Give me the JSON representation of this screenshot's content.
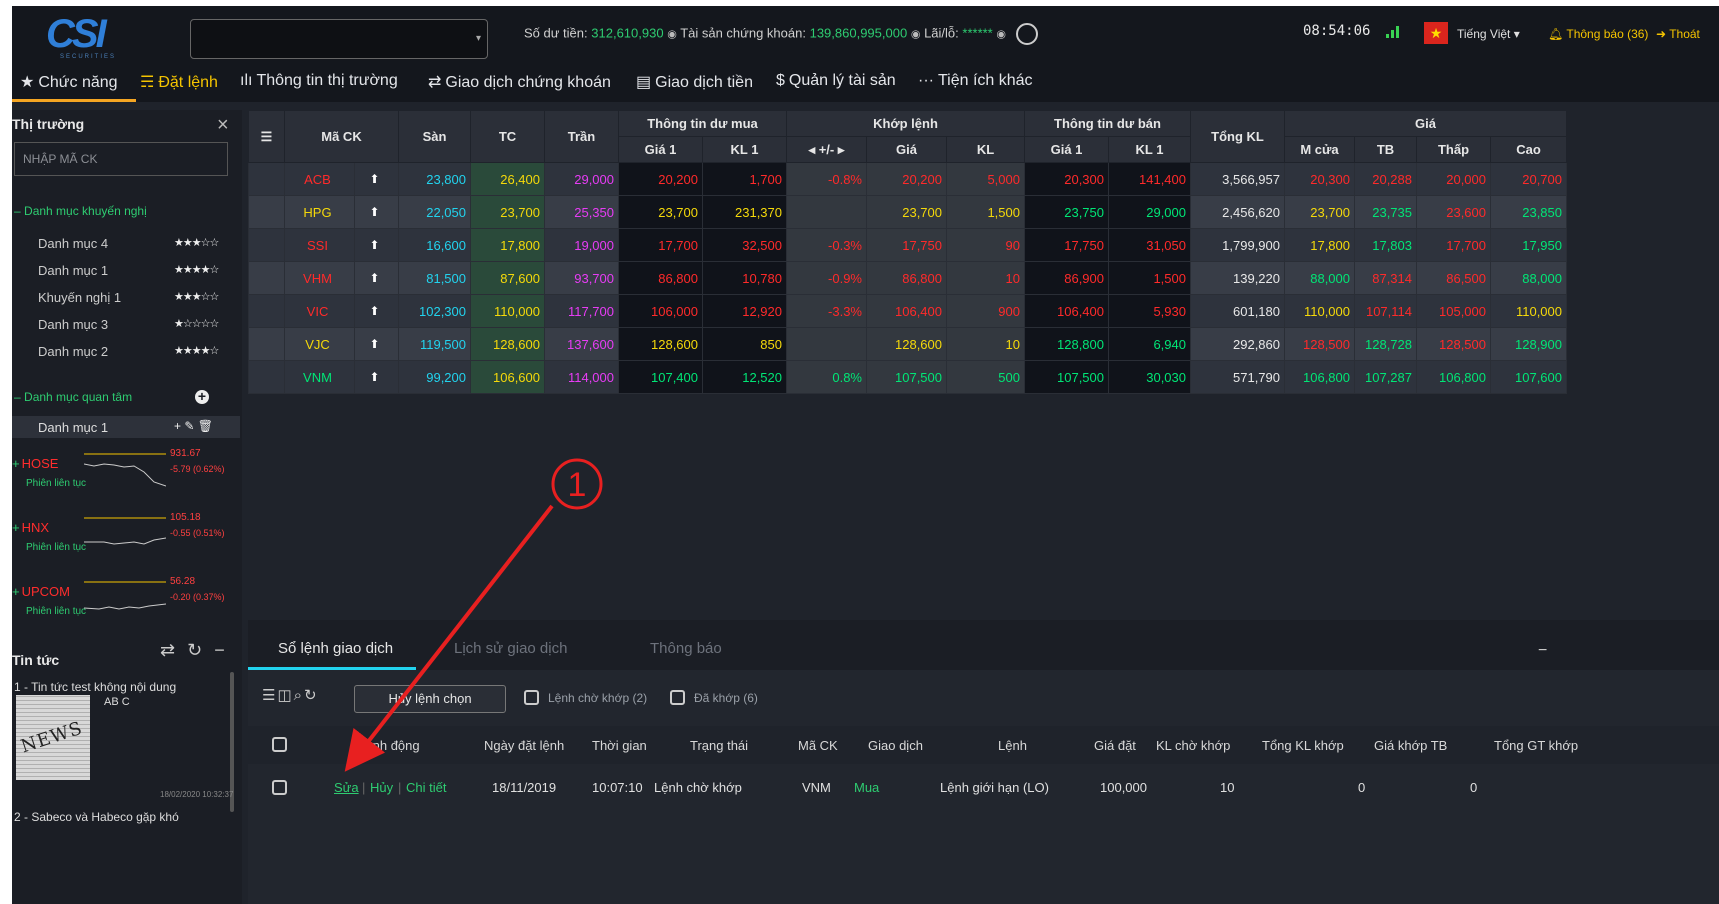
{
  "topbar": {
    "logo": "CSI",
    "logo_sub": "SECURITIES",
    "account_select": "",
    "balance_label": "Số dư tiền:",
    "balance_value": "312,610,930",
    "assets_label": "Tài sản chứng khoán:",
    "assets_value": "139,860,995,000",
    "pnl_label": "Lãi/lỗ:",
    "pnl_value": "******",
    "clock": "08:54:06",
    "language": "Tiếng Việt",
    "notifications": "Thông báo (36)",
    "logout": "Thoát"
  },
  "menu": [
    {
      "label": "Chức năng",
      "icon": "star-icon"
    },
    {
      "label": "Đặt lệnh",
      "icon": "cart-icon"
    },
    {
      "label": "Thông tin thị trường",
      "icon": "bar-chart-icon"
    },
    {
      "label": "Giao dịch chứng khoán",
      "icon": "transfer-icon"
    },
    {
      "label": "Giao dịch tiền",
      "icon": "cash-icon"
    },
    {
      "label": "Quản lý tài sản",
      "icon": "dollar-icon"
    },
    {
      "label": "Tiện ích khác",
      "icon": "more-icon"
    }
  ],
  "sidebar": {
    "title": "Thị trường",
    "search_placeholder": "NHẬP MÃ CK",
    "recommended_group": "Danh mục khuyến nghị",
    "recommended": [
      {
        "name": "Danh mục 4",
        "stars": "★★★☆☆"
      },
      {
        "name": "Danh mục 1",
        "stars": "★★★★☆"
      },
      {
        "name": "Khuyến nghị 1",
        "stars": "★★★☆☆"
      },
      {
        "name": "Danh mục 3",
        "stars": "★☆☆☆☆"
      },
      {
        "name": "Danh mục 2",
        "stars": "★★★★☆"
      }
    ],
    "watch_group": "Danh mục quan tâm",
    "watch_item": "Danh mục 1",
    "watch_actions": "+ ✎ 🗑",
    "indices": [
      {
        "name": "HOSE",
        "value": "931.67",
        "change": "-5.79 (0.62%)",
        "session": "Phiên liên tục"
      },
      {
        "name": "HNX",
        "value": "105.18",
        "change": "-0.55 (0.51%)",
        "session": "Phiên liên tục"
      },
      {
        "name": "UPCOM",
        "value": "56.28",
        "change": "-0.20 (0.37%)",
        "session": "Phiên liên tục"
      }
    ],
    "news_title": "Tin tức",
    "news": [
      {
        "title": "1 - Tin tức test không nội dung",
        "sub": "AB C",
        "image_text": "NEWS",
        "date": "18/02/2020 10:32:37"
      },
      {
        "title": "2 - Sabeco và Habeco gặp khó"
      }
    ]
  },
  "market": {
    "headers": {
      "symbol": "Mã CK",
      "floor": "Sàn",
      "ref": "TC",
      "ceil": "Trần",
      "bid_group": "Thông tin dư mua",
      "match_group": "Khớp lệnh",
      "ask_group": "Thông tin dư bán",
      "total": "Tổng KL",
      "price_group": "Giá",
      "bid_p": "Giá 1",
      "bid_v": "KL 1",
      "chg": "+/-",
      "match_p": "Giá",
      "match_v": "KL",
      "ask_p": "Giá 1",
      "ask_v": "KL 1",
      "open": "M cửa",
      "avg": "TB",
      "low": "Thấp",
      "high": "Cao"
    },
    "rows": [
      {
        "sym": "ACB",
        "floor": "23,800",
        "ref": "26,400",
        "ceil": "29,000",
        "bid_p": "20,200",
        "bid_v": "1,700",
        "chg": "-0.8%",
        "match_p": "20,200",
        "match_v": "5,000",
        "ask_p": "20,300",
        "ask_v": "141,400",
        "total": "3,566,957",
        "open": "20,300",
        "avg": "20,288",
        "low": "20,000",
        "high": "20,700"
      },
      {
        "sym": "HPG",
        "floor": "22,050",
        "ref": "23,700",
        "ceil": "25,350",
        "bid_p": "23,700",
        "bid_v": "231,370",
        "chg": "",
        "match_p": "23,700",
        "match_v": "1,500",
        "ask_p": "23,750",
        "ask_v": "29,000",
        "total": "2,456,620",
        "open": "23,700",
        "avg": "23,735",
        "low": "23,600",
        "high": "23,850"
      },
      {
        "sym": "SSI",
        "floor": "16,600",
        "ref": "17,800",
        "ceil": "19,000",
        "bid_p": "17,700",
        "bid_v": "32,500",
        "chg": "-0.3%",
        "match_p": "17,750",
        "match_v": "90",
        "ask_p": "17,750",
        "ask_v": "31,050",
        "total": "1,799,900",
        "open": "17,800",
        "avg": "17,803",
        "low": "17,700",
        "high": "17,950"
      },
      {
        "sym": "VHM",
        "floor": "81,500",
        "ref": "87,600",
        "ceil": "93,700",
        "bid_p": "86,800",
        "bid_v": "10,780",
        "chg": "-0.9%",
        "match_p": "86,800",
        "match_v": "10",
        "ask_p": "86,900",
        "ask_v": "1,500",
        "total": "139,220",
        "open": "88,000",
        "avg": "87,314",
        "low": "86,500",
        "high": "88,000"
      },
      {
        "sym": "VIC",
        "floor": "102,300",
        "ref": "110,000",
        "ceil": "117,700",
        "bid_p": "106,000",
        "bid_v": "12,920",
        "chg": "-3.3%",
        "match_p": "106,400",
        "match_v": "900",
        "ask_p": "106,400",
        "ask_v": "5,930",
        "total": "601,180",
        "open": "110,000",
        "avg": "107,114",
        "low": "105,000",
        "high": "110,000"
      },
      {
        "sym": "VJC",
        "floor": "119,500",
        "ref": "128,600",
        "ceil": "137,600",
        "bid_p": "128,600",
        "bid_v": "850",
        "chg": "",
        "match_p": "128,600",
        "match_v": "10",
        "ask_p": "128,800",
        "ask_v": "6,940",
        "total": "292,860",
        "open": "128,500",
        "avg": "128,728",
        "low": "128,500",
        "high": "128,900"
      },
      {
        "sym": "VNM",
        "floor": "99,200",
        "ref": "106,600",
        "ceil": "114,000",
        "bid_p": "107,400",
        "bid_v": "12,520",
        "chg": "0.8%",
        "match_p": "107,500",
        "match_v": "500",
        "ask_p": "107,500",
        "ask_v": "30,030",
        "total": "571,790",
        "open": "106,800",
        "avg": "107,287",
        "low": "106,800",
        "high": "107,600"
      }
    ]
  },
  "orders": {
    "tabs": [
      "Sổ lệnh giao dịch",
      "Lịch sử giao dịch",
      "Thông báo"
    ],
    "cancel_selected": "Hủy lệnh chọn",
    "filter_pending": "Lệnh chờ khớp (2)",
    "filter_matched": "Đã khớp (6)",
    "headers": [
      "Hành động",
      "Ngày đặt lệnh",
      "Thời gian",
      "Trạng thái",
      "Mã CK",
      "Giao dịch",
      "Lệnh",
      "Giá đặt",
      "KL chờ khớp",
      "Tổng KL khớp",
      "Giá khớp TB",
      "Tổng GT khớp"
    ],
    "row": {
      "edit": "Sửa",
      "cancel": "Hủy",
      "detail": "Chi tiết",
      "date": "18/11/2019",
      "time": "10:07:10",
      "status": "Lệnh chờ khớp",
      "symbol": "VNM",
      "side": "Mua",
      "type": "Lệnh giới hạn (LO)",
      "price": "100,000",
      "pending_qty": "10",
      "matched_qty": "0",
      "avg_price": "0"
    }
  },
  "annotation": {
    "number": "1"
  }
}
